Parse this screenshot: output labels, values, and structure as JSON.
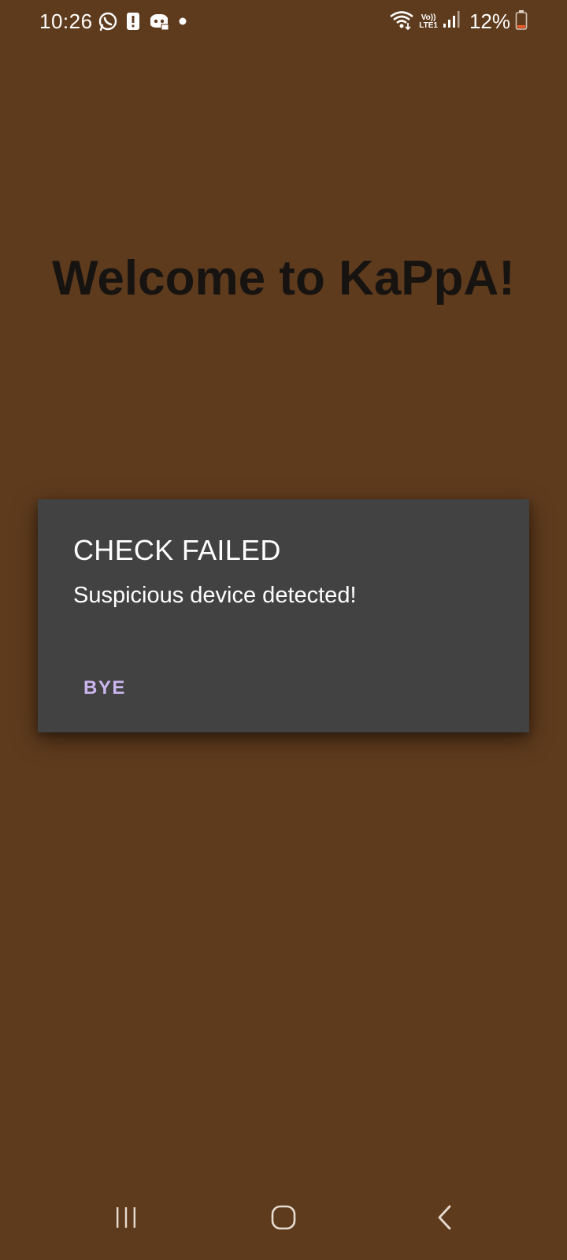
{
  "status_bar": {
    "time": "10:26",
    "battery_percent": "12%",
    "network_label_top": "Vo))",
    "network_label_bottom": "LTE1",
    "left_icons": [
      "whatsapp-icon",
      "alert-notification-icon",
      "discord-icon",
      "notification-dot-icon"
    ],
    "right_icons": [
      "wifi-icon",
      "volte-lte-icon",
      "signal-icon",
      "battery-low-icon"
    ]
  },
  "page": {
    "title": "Welcome to KaPpA!",
    "background_color": "#5f3b1d"
  },
  "dialog": {
    "title": "CHECK FAILED",
    "message": "Suspicious device detected!",
    "button_label": "BYE",
    "background_color": "#424242",
    "button_color": "#cbb6ef"
  },
  "nav_bar": {
    "items": [
      "recent-apps-icon",
      "home-icon",
      "back-icon"
    ]
  }
}
